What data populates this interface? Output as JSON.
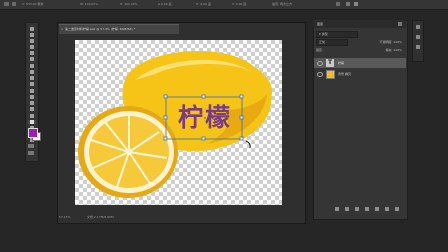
{
  "options_bar": {
    "items": [
      "X: 533.00 像素",
      "W: 100.00%",
      "H: 100.00%",
      "Δ 0.00 度",
      "H: 0.00 度",
      "V: 0.00 度",
      "插值: 两次立方"
    ]
  },
  "document": {
    "tab_title": "第二章原材料柠檬.psd @ 57.4% (柠檬, RGB/8#) *",
    "close_glyph": "×",
    "zoom": "57.15%",
    "doc_info": "文档:2.17M/8.60M"
  },
  "canvas": {
    "text_layer": "柠檬",
    "text_color": "#7a3a86"
  },
  "layers_panel": {
    "title": "图层",
    "filter": "P 类型",
    "blend_mode": "正常",
    "opacity_label": "不透明度: 100%",
    "lock_label": "锁定:",
    "fill_label": "填充: 100%",
    "layers": [
      {
        "name": "柠檬",
        "type": "text",
        "thumb": "T",
        "selected": true
      },
      {
        "name": "背景 拷贝",
        "type": "image",
        "thumb": "",
        "selected": false
      }
    ]
  },
  "colors": {
    "foreground": "#9b1fb0",
    "background": "#ffffff",
    "lemon": "#f3c21b",
    "selection": "#3e6bb0"
  },
  "icons": [
    "move-icon",
    "marquee-icon",
    "lasso-icon",
    "quick-select-icon",
    "crop-icon",
    "eyedropper-icon",
    "healing-icon",
    "brush-icon",
    "stamp-icon",
    "history-brush-icon",
    "eraser-icon",
    "gradient-icon",
    "blur-icon",
    "dodge-icon",
    "pen-icon",
    "type-icon",
    "path-select-icon",
    "shape-icon",
    "hand-icon",
    "zoom-icon"
  ]
}
